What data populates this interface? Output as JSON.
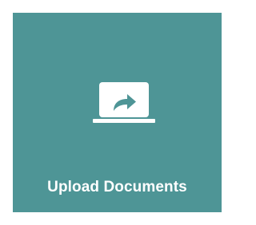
{
  "tile": {
    "label": "Upload Documents",
    "icon": "laptop-share-icon",
    "background_color": "#4e9596",
    "icon_color": "#ffffff",
    "label_color": "#ffffff"
  }
}
